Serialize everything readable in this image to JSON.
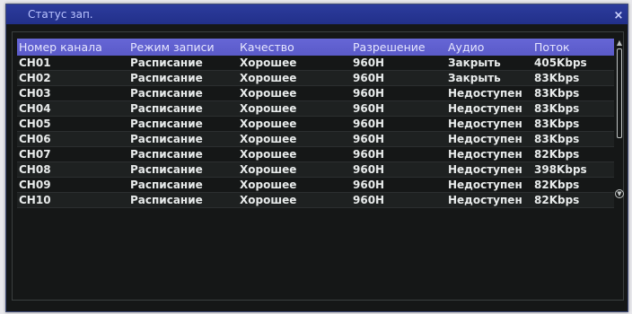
{
  "window": {
    "title": "Статус зап.",
    "close_glyph": "×"
  },
  "table": {
    "headers": [
      "Номер канала",
      "Режим записи",
      "Качество",
      "Разрешение",
      "Аудио",
      "Поток"
    ],
    "rows": [
      [
        "CH01",
        "Расписание",
        "Хорошее",
        "960H",
        "Закрыть",
        "405Kbps"
      ],
      [
        "CH02",
        "Расписание",
        "Хорошее",
        "960H",
        "Закрыть",
        "83Kbps"
      ],
      [
        "CH03",
        "Расписание",
        "Хорошее",
        "960H",
        "Недоступен",
        "83Kbps"
      ],
      [
        "CH04",
        "Расписание",
        "Хорошее",
        "960H",
        "Недоступен",
        "83Kbps"
      ],
      [
        "CH05",
        "Расписание",
        "Хорошее",
        "960H",
        "Недоступен",
        "83Kbps"
      ],
      [
        "CH06",
        "Расписание",
        "Хорошее",
        "960H",
        "Недоступен",
        "83Kbps"
      ],
      [
        "CH07",
        "Расписание",
        "Хорошее",
        "960H",
        "Недоступен",
        "82Kbps"
      ],
      [
        "CH08",
        "Расписание",
        "Хорошее",
        "960H",
        "Недоступен",
        "398Kbps"
      ],
      [
        "CH09",
        "Расписание",
        "Хорошее",
        "960H",
        "Недоступен",
        "82Kbps"
      ],
      [
        "CH10",
        "Расписание",
        "Хорошее",
        "960H",
        "Недоступен",
        "82Kbps"
      ]
    ]
  },
  "icons": {
    "close": "close-icon",
    "scroll_up": "chevron-up-icon",
    "scroll_down": "chevron-down-icon"
  },
  "colors": {
    "title_bar": "#2c3b9c",
    "header_row": "#6262d0",
    "background": "#151717",
    "text": "#e8ebeb"
  }
}
